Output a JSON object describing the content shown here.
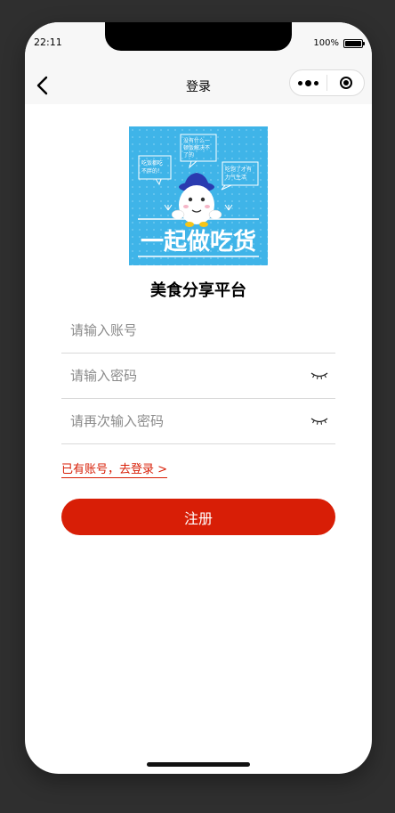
{
  "status_bar": {
    "time": "22:11",
    "battery_percent": "100%",
    "battery_level": 1.0
  },
  "nav": {
    "title": "登录",
    "back_icon": "chevron-left-icon",
    "more_icon": "more-dots-icon",
    "close_icon": "target-circle-icon"
  },
  "logo": {
    "banner_text": "一起做吃货",
    "bubble_left": "吃饭都吃不胖的！",
    "bubble_top": "没有什么一顿饭解决不了的",
    "bubble_right": "吃饱了才有力气生活",
    "background_color": "#3fb4e8"
  },
  "app_title": "美食分享平台",
  "form": {
    "account_placeholder": "请输入账号",
    "password_placeholder": "请输入密码",
    "confirm_placeholder": "请再次输入密码",
    "eye_icon": "eye-closed-icon"
  },
  "login_link": "已有账号，去登录 >",
  "register_label": "注册",
  "colors": {
    "accent": "#d81e06",
    "nav_background": "#f7f7f7"
  }
}
